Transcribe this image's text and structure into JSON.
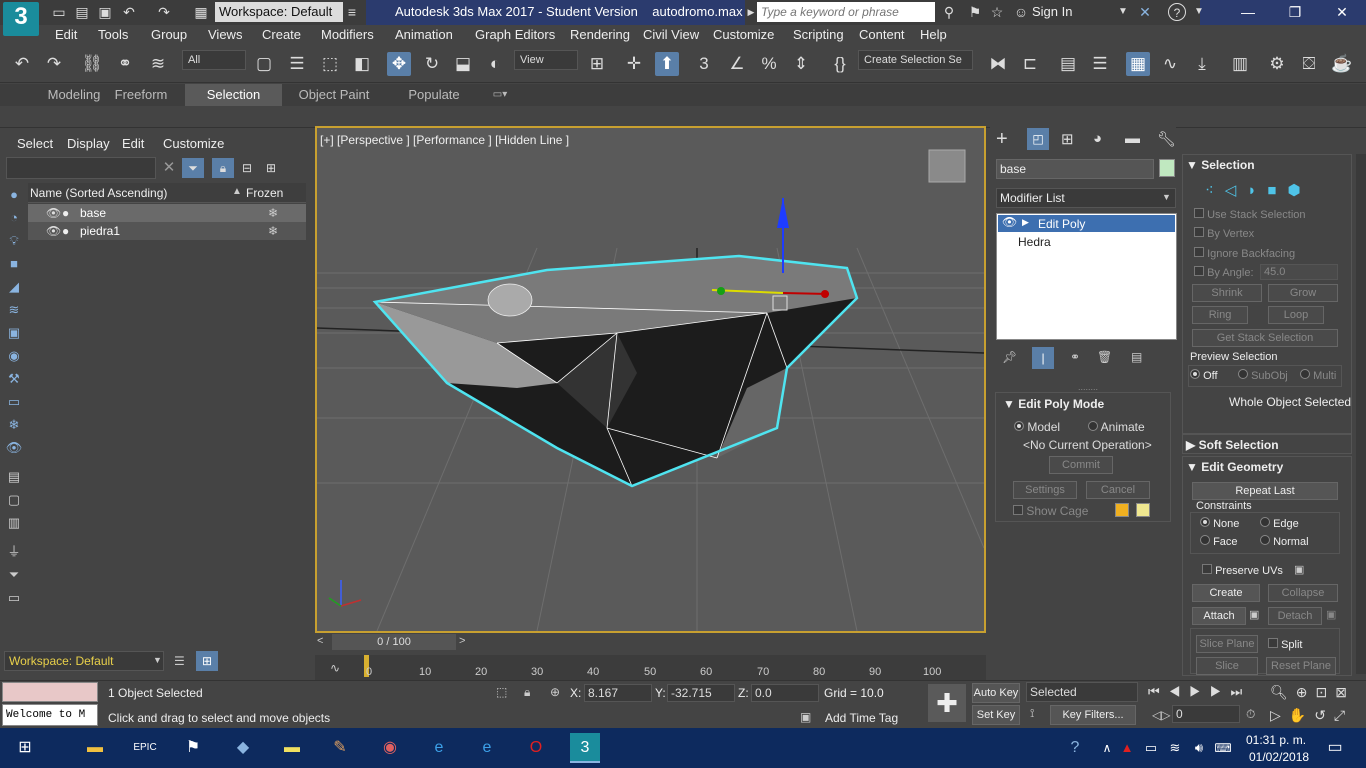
{
  "titlebar": {
    "workspace": "Workspace: Default",
    "title": "Autodesk 3ds Max 2017 - Student Version",
    "file": "autodromo.max",
    "search_placeholder": "Type a keyword or phrase",
    "signin": "Sign In",
    "logo": "3"
  },
  "menu": [
    "Edit",
    "Tools",
    "Group",
    "Views",
    "Create",
    "Modifiers",
    "Animation",
    "Graph Editors",
    "Rendering",
    "Civil View",
    "Customize",
    "Scripting",
    "Content",
    "Help"
  ],
  "toolbar": {
    "filter": "All",
    "refcoord": "View",
    "selection_set": "Create Selection Se"
  },
  "ribbon_tabs": [
    "Modeling",
    "Freeform",
    "Selection",
    "Object Paint",
    "Populate"
  ],
  "ribbon_active": "Selection",
  "scene_explorer": {
    "menus": [
      "Select",
      "Display",
      "Edit",
      "Customize"
    ],
    "col_name": "Name (Sorted Ascending)",
    "col_frozen": "Frozen",
    "objects": [
      {
        "name": "base",
        "selected": true
      },
      {
        "name": "piedra1",
        "selected": false
      }
    ],
    "workspace": "Workspace: Default"
  },
  "viewport": {
    "label": "[+] [Perspective ] [Performance ] [Hidden Line ]"
  },
  "timeline": {
    "frame": "0 / 100",
    "ticks": [
      "0",
      "10",
      "20",
      "30",
      "40",
      "50",
      "60",
      "70",
      "80",
      "90",
      "100"
    ]
  },
  "status": {
    "selected": "1 Object Selected",
    "prompt": "Click and drag to select and move objects",
    "maxscript": "Welcome to M",
    "x_label": "X:",
    "x": "8.167",
    "y_label": "Y:",
    "y": "-32.715",
    "z_label": "Z:",
    "z": "0.0",
    "grid": "Grid = 10.0",
    "add_time_tag": "Add Time Tag",
    "auto_key": "Auto Key",
    "set_key": "Set Key",
    "selected_dd": "Selected",
    "key_filters": "Key Filters...",
    "frame_field": "0"
  },
  "command_panel": {
    "object_name": "base",
    "modifier_list": "Modifier List",
    "stack": [
      "Edit Poly",
      "Hedra"
    ],
    "edit_poly_mode": "Edit Poly Mode",
    "model": "Model",
    "animate": "Animate",
    "no_op": "<No Current Operation>",
    "commit": "Commit",
    "settings": "Settings",
    "cancel": "Cancel",
    "show_cage": "Show Cage"
  },
  "rollout": {
    "selection": "Selection",
    "use_stack": "Use Stack Selection",
    "by_vertex": "By Vertex",
    "ignore_backfacing": "Ignore Backfacing",
    "by_angle": "By Angle:",
    "angle": "45.0",
    "shrink": "Shrink",
    "grow": "Grow",
    "ring": "Ring",
    "loop": "Loop",
    "get_stack": "Get Stack Selection",
    "preview": "Preview Selection",
    "off": "Off",
    "subobj": "SubObj",
    "multi": "Multi",
    "whole": "Whole Object Selected",
    "soft": "Soft Selection",
    "edit_geom": "Edit Geometry",
    "repeat_last": "Repeat Last",
    "constraints": "Constraints",
    "none": "None",
    "edge": "Edge",
    "face": "Face",
    "normal": "Normal",
    "preserve_uvs": "Preserve UVs",
    "create": "Create",
    "collapse": "Collapse",
    "attach": "Attach",
    "detach": "Detach",
    "slice_plane": "Slice Plane",
    "split": "Split",
    "slice": "Slice",
    "reset_plane": "Reset Plane"
  },
  "taskbar": {
    "time": "01:31 p. m.",
    "date": "01/02/2018"
  }
}
